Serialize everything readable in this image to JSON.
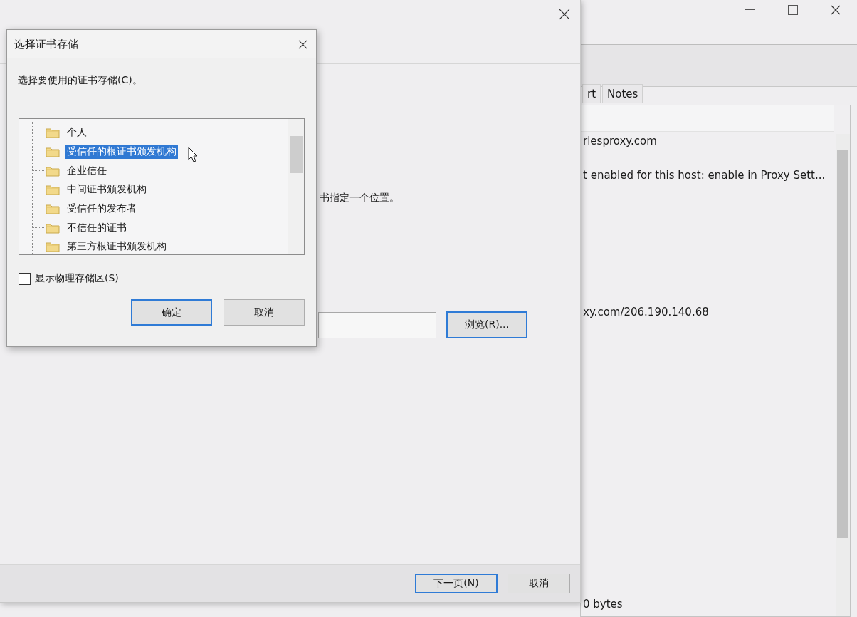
{
  "app_window": {
    "tabs": [
      {
        "label": "rt",
        "selected": false
      },
      {
        "label": "Notes",
        "selected": false
      }
    ],
    "lines": [
      "rlesproxy.com",
      "t enabled for this host: enable in Proxy Sett...",
      "xy.com/206.190.140.68",
      "0 bytes"
    ]
  },
  "wizard": {
    "instruction": "书指定一个位置。",
    "browse_button": "浏览(R)...",
    "buttons": [
      {
        "label": "下一页(N)",
        "default": true
      },
      {
        "label": "取消",
        "default": false
      }
    ]
  },
  "dialog": {
    "title": "选择证书存储",
    "prompt": "选择要使用的证书存储(C)。",
    "stores": [
      {
        "label": "个人",
        "selected": false
      },
      {
        "label": "受信任的根证书颁发机构",
        "selected": true
      },
      {
        "label": "企业信任",
        "selected": false
      },
      {
        "label": "中间证书颁发机构",
        "selected": false
      },
      {
        "label": "受信任的发布者",
        "selected": false
      },
      {
        "label": "不信任的证书",
        "selected": false
      },
      {
        "label": "第三方根证书颁发机构",
        "selected": false
      }
    ],
    "show_physical": {
      "label": "显示物理存储区(S)",
      "checked": false
    },
    "buttons": [
      {
        "label": "确定",
        "default": true
      },
      {
        "label": "取消",
        "default": false
      }
    ]
  }
}
